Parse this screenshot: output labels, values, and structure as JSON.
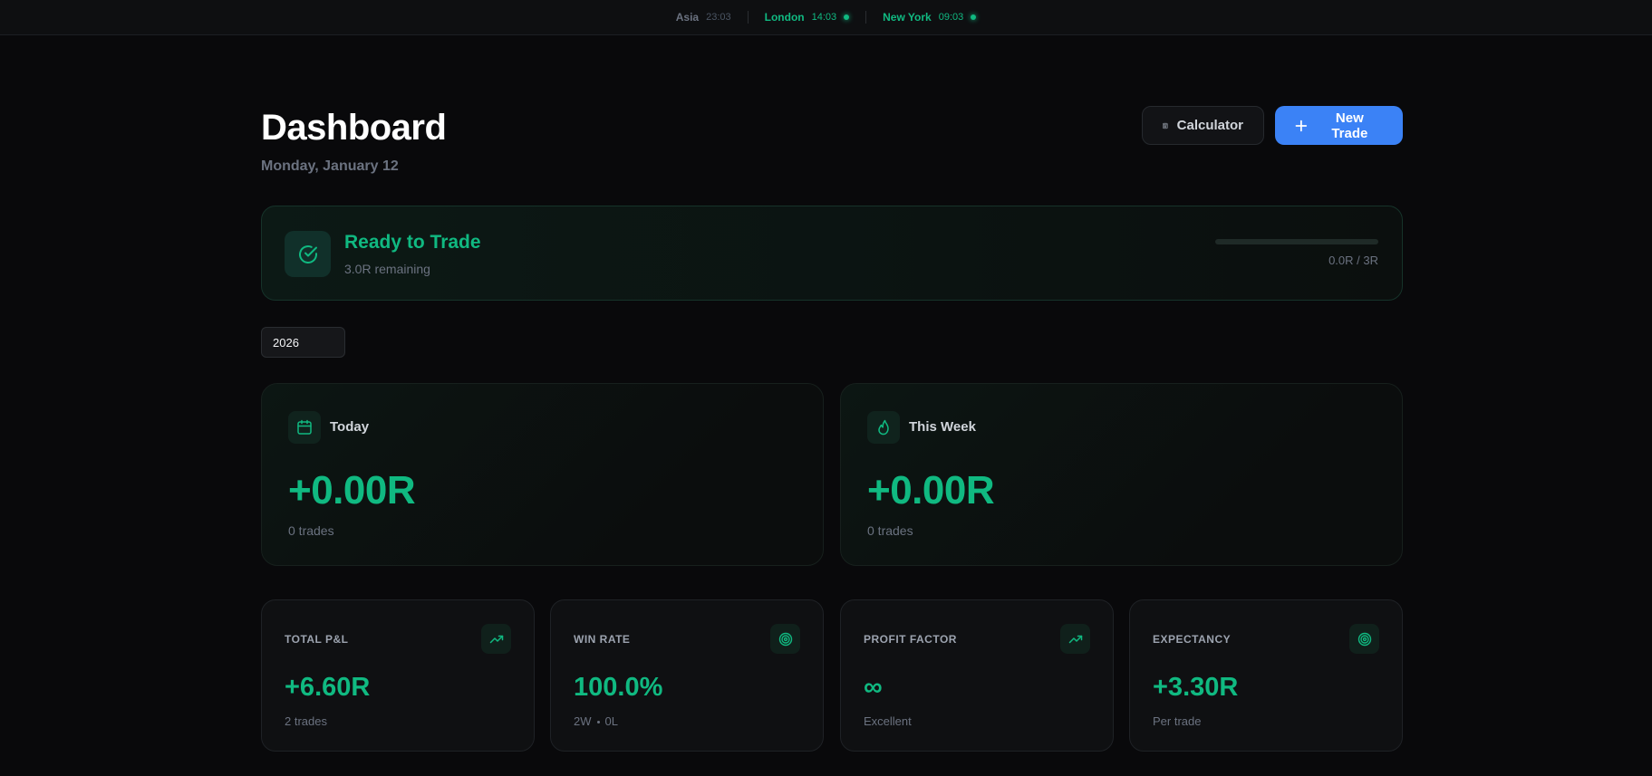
{
  "sessions": [
    {
      "name": "Asia",
      "time": "23:03",
      "active": false
    },
    {
      "name": "London",
      "time": "14:03",
      "active": true
    },
    {
      "name": "New York",
      "time": "09:03",
      "active": true
    }
  ],
  "header": {
    "title": "Dashboard",
    "date": "Monday, January 12",
    "calculator_label": "Calculator",
    "new_trade_label": "New Trade"
  },
  "status": {
    "title": "Ready to Trade",
    "remaining": "3.0R remaining",
    "ratio": "0.0R / 3R",
    "progress_fraction": 0.0
  },
  "year_filter": {
    "selected": "2026"
  },
  "periods": {
    "today": {
      "label": "Today",
      "value": "+0.00R",
      "trades": "0 trades"
    },
    "week": {
      "label": "This Week",
      "value": "+0.00R",
      "trades": "0 trades"
    }
  },
  "stats": {
    "total_pnl": {
      "label": "TOTAL P&L",
      "value": "+6.60R",
      "sub": "2 trades"
    },
    "win_rate": {
      "label": "WIN RATE",
      "value": "100.0%",
      "wins": "2W",
      "losses": "0L"
    },
    "profit_factor": {
      "label": "PROFIT FACTOR",
      "value": "∞",
      "sub": "Excellent"
    },
    "expectancy": {
      "label": "EXPECTANCY",
      "value": "+3.30R",
      "sub": "Per trade"
    }
  },
  "colors": {
    "accent_green": "#10b981",
    "primary_blue": "#3b82f6",
    "background": "#09090b"
  }
}
